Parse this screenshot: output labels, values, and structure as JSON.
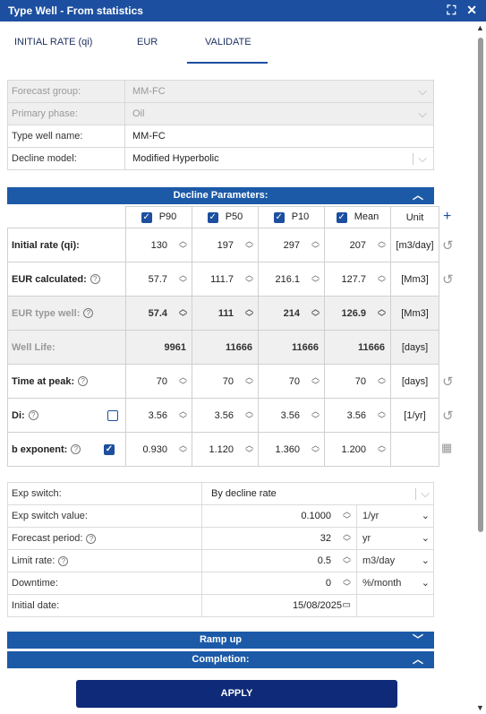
{
  "window": {
    "title": "Type Well - From statistics"
  },
  "tabs": [
    {
      "label": "INITIAL RATE (qi)"
    },
    {
      "label": "EUR"
    },
    {
      "label": "VALIDATE"
    }
  ],
  "form": {
    "forecast_group_label": "Forecast group:",
    "forecast_group_value": "MM-FC",
    "primary_phase_label": "Primary phase:",
    "primary_phase_value": "Oil",
    "type_well_name_label": "Type well name:",
    "type_well_name_value": "MM-FC",
    "decline_model_label": "Decline model:",
    "decline_model_value": "Modified Hyperbolic"
  },
  "decline": {
    "section_title": "Decline Parameters:",
    "columns": [
      "P90",
      "P50",
      "P10",
      "Mean"
    ],
    "unit_header": "Unit",
    "rows": [
      {
        "label": "Initial rate (qi):",
        "values": [
          "130",
          "197",
          "297",
          "207"
        ],
        "unit": "[m3/day]"
      },
      {
        "label": "EUR calculated:",
        "values": [
          "57.7",
          "111.7",
          "216.1",
          "127.7"
        ],
        "unit": "[Mm3]"
      },
      {
        "label": "EUR type well:",
        "values": [
          "57.4",
          "111",
          "214",
          "126.9"
        ],
        "unit": "[Mm3]"
      },
      {
        "label": "Well Life:",
        "values": [
          "9961",
          "11666",
          "11666",
          "11666"
        ],
        "unit": "[days]"
      },
      {
        "label": "Time at peak:",
        "values": [
          "70",
          "70",
          "70",
          "70"
        ],
        "unit": "[days]"
      },
      {
        "label": "Di:",
        "values": [
          "3.56",
          "3.56",
          "3.56",
          "3.56"
        ],
        "unit": "[1/yr]"
      },
      {
        "label": "b exponent:",
        "values": [
          "0.930",
          "1.120",
          "1.360",
          "1.200"
        ],
        "unit": ""
      }
    ]
  },
  "options": {
    "exp_switch_label": "Exp switch:",
    "exp_switch_value": "By decline rate",
    "exp_switch_value_label": "Exp switch value:",
    "exp_switch_value_value": "0.1000",
    "exp_switch_value_unit": "1/yr",
    "forecast_period_label": "Forecast period:",
    "forecast_period_value": "32",
    "forecast_period_unit": "yr",
    "limit_rate_label": "Limit rate:",
    "limit_rate_value": "0.5",
    "limit_rate_unit": "m3/day",
    "downtime_label": "Downtime:",
    "downtime_value": "0",
    "downtime_unit": "%/month",
    "initial_date_label": "Initial date:",
    "initial_date_value": "15/08/2025"
  },
  "sections": {
    "ramp_up": "Ramp up",
    "completion": "Completion:"
  },
  "apply_label": "APPLY"
}
